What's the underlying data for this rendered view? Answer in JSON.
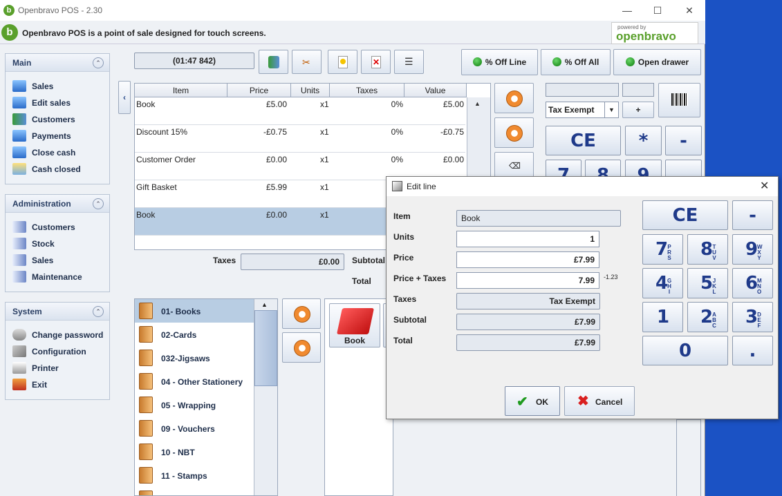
{
  "window": {
    "title": "Openbravo POS - 2.30",
    "banner_text": "Openbravo POS is a point of sale designed for touch screens.",
    "logo_small": "powered by",
    "logo_name": "openbravo"
  },
  "sidebar": {
    "main": {
      "title": "Main",
      "items": [
        "Sales",
        "Edit sales",
        "Customers",
        "Payments",
        "Close cash",
        "Cash closed"
      ]
    },
    "administration": {
      "title": "Administration",
      "items": [
        "Customers",
        "Stock",
        "Sales",
        "Maintenance"
      ]
    },
    "system": {
      "title": "System",
      "items": [
        "Change password",
        "Configuration",
        "Printer",
        "Exit"
      ]
    }
  },
  "ticket": {
    "id_label": "(01:47 842)"
  },
  "actions": {
    "off_line": "% Off Line",
    "off_all": "% Off All",
    "open_drawer": "Open drawer"
  },
  "table": {
    "headers": [
      "Item",
      "Price",
      "Units",
      "Taxes",
      "Value"
    ],
    "rows": [
      {
        "item": "Book",
        "price": "£5.00",
        "units": "x1",
        "taxes": "0%",
        "value": "£5.00"
      },
      {
        "item": "Discount 15%",
        "price": "-£0.75",
        "units": "x1",
        "taxes": "0%",
        "value": "-£0.75"
      },
      {
        "item": "Customer Order",
        "price": "£0.00",
        "units": "x1",
        "taxes": "0%",
        "value": "£0.00"
      },
      {
        "item": "Gift Basket",
        "price": "£5.99",
        "units": "x1",
        "taxes": "",
        "value": ""
      },
      {
        "item": "Book",
        "price": "£0.00",
        "units": "x1",
        "taxes": "",
        "value": ""
      }
    ]
  },
  "totals": {
    "taxes_label": "Taxes",
    "taxes_value": "£0.00",
    "subtotal_label": "Subtotal",
    "total_label": "Total"
  },
  "right_panel": {
    "tax_select": "Tax Exempt",
    "plus": "+",
    "keys": [
      "CE",
      "*",
      "-"
    ],
    "partial_keys": [
      "7",
      "8",
      "9"
    ]
  },
  "categories": [
    "01- Books",
    "02-Cards",
    "032-Jigsaws",
    "04 - Other Stationery",
    "05 - Wrapping",
    "09 - Vouchers",
    "10 - NBT",
    "11 - Stamps"
  ],
  "products": [
    {
      "name": "Book"
    }
  ],
  "dialog": {
    "title": "Edit line",
    "fields": {
      "item_label": "Item",
      "item_value": "Book",
      "units_label": "Units",
      "units_value": "1",
      "price_label": "Price",
      "price_value": "£7.99",
      "price_taxes_label": "Price + Taxes",
      "price_taxes_value": "7.99",
      "price_taxes_note": "-1.23",
      "taxes_label": "Taxes",
      "taxes_value": "Tax Exempt",
      "subtotal_label": "Subtotal",
      "subtotal_value": "£7.99",
      "total_label": "Total",
      "total_value": "£7.99"
    },
    "keypad": {
      "ce": "CE",
      "minus": "-",
      "zero": "0",
      "dot": ".",
      "digits": [
        {
          "d": "7",
          "s": "PRS"
        },
        {
          "d": "8",
          "s": "TUV"
        },
        {
          "d": "9",
          "s": "WXY"
        },
        {
          "d": "4",
          "s": "GHI"
        },
        {
          "d": "5",
          "s": "JKL"
        },
        {
          "d": "6",
          "s": "MNO"
        },
        {
          "d": "1",
          "s": ""
        },
        {
          "d": "2",
          "s": "ABC"
        },
        {
          "d": "3",
          "s": "DEF"
        }
      ]
    },
    "ok_label": "OK",
    "cancel_label": "Cancel"
  }
}
